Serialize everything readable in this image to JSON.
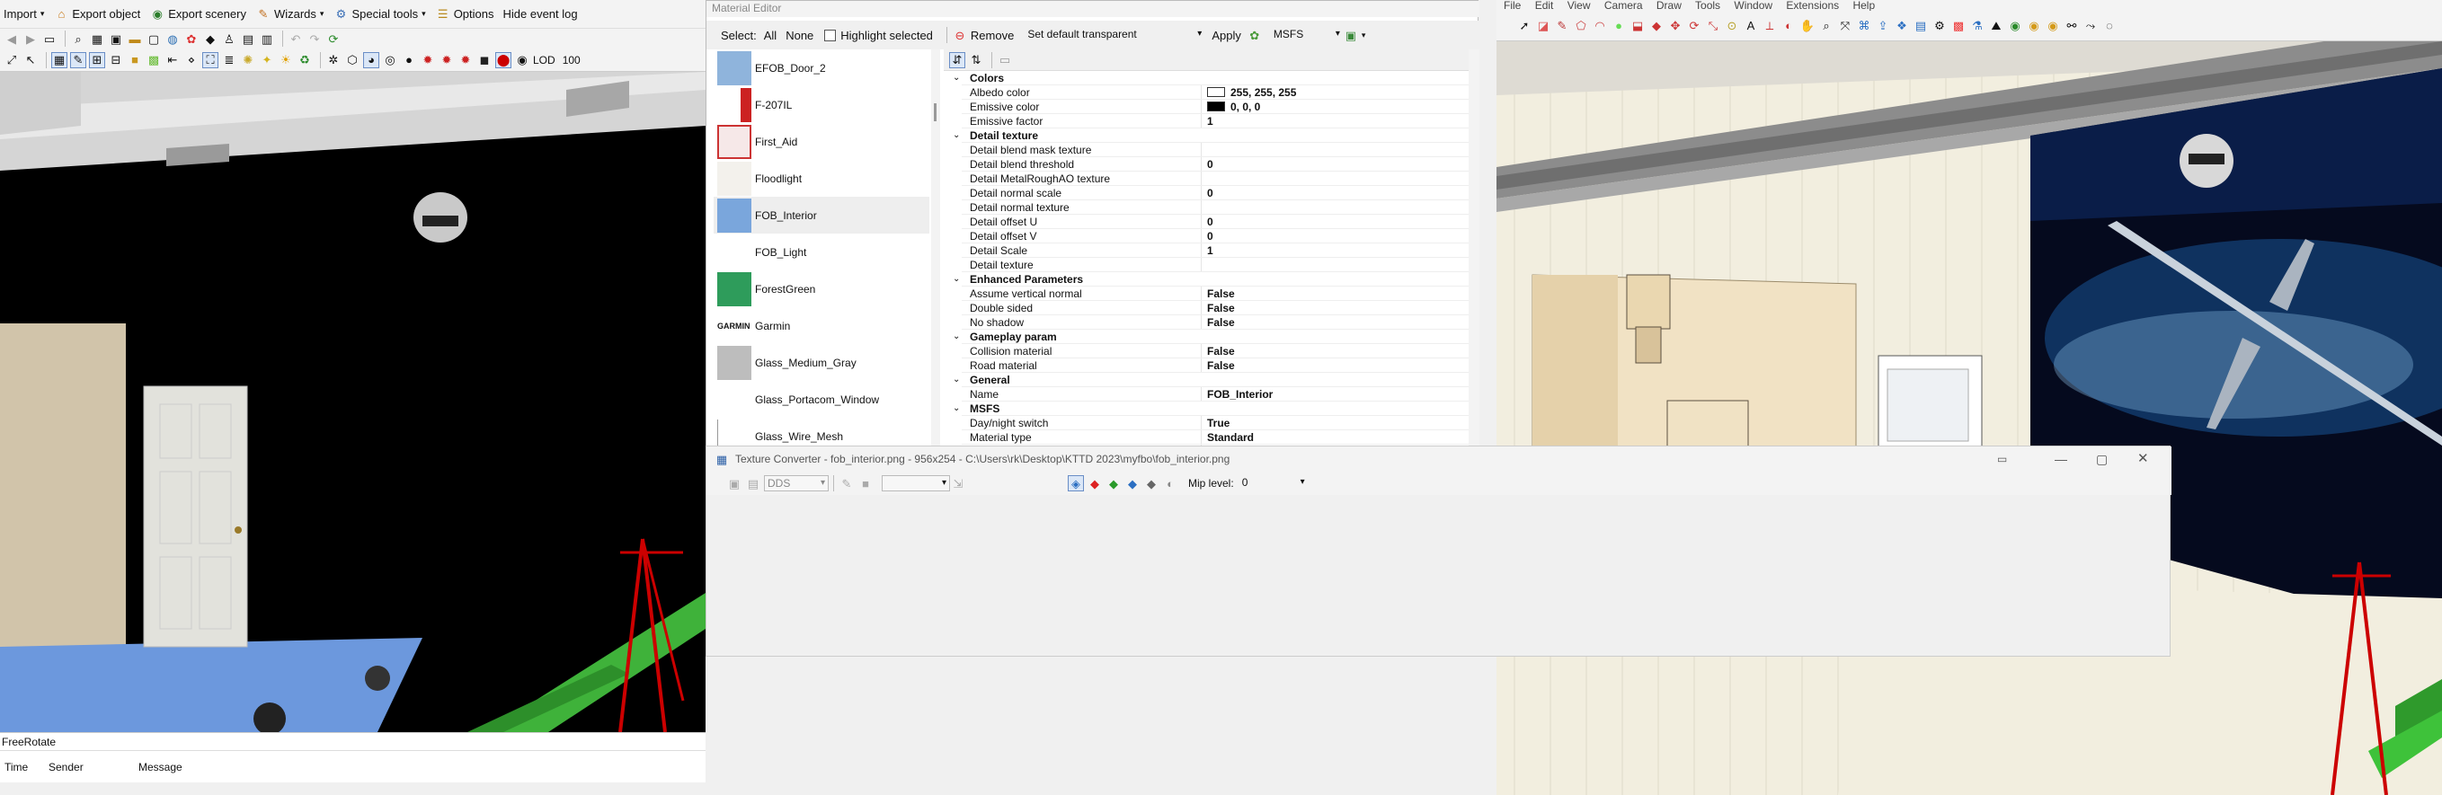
{
  "left_app": {
    "menu": {
      "import": "Import",
      "export_object": "Export object",
      "export_scenery": "Export scenery",
      "wizards": "Wizards",
      "special_tools": "Special tools",
      "options": "Options",
      "hide_event_log": "Hide event log"
    },
    "lod_label": "LOD",
    "lod_value": "100",
    "status_text": "FreeRotate",
    "log_columns": [
      "Time",
      "Sender",
      "Message"
    ]
  },
  "material_editor": {
    "title": "Material Editor",
    "toolbar": {
      "select_label": "Select:",
      "all": "All",
      "none": "None",
      "highlight_selected": "Highlight selected",
      "remove": "Remove",
      "default_transparent": "Set default transparent",
      "apply": "Apply",
      "msfs": "MSFS"
    },
    "materials": [
      {
        "name": "EFOB_Door_2",
        "swatch": "#8fb4dc"
      },
      {
        "name": "F-207IL",
        "swatch": "#ffffff"
      },
      {
        "name": "First_Aid",
        "swatch": "#f2e4e4"
      },
      {
        "name": "Floodlight",
        "swatch": "#f3f1ec"
      },
      {
        "name": "FOB_Interior",
        "swatch": "#7aa6dc"
      },
      {
        "name": "FOB_Light",
        "swatch": "#ffffff"
      },
      {
        "name": "ForestGreen",
        "swatch": "#2e9c5b"
      },
      {
        "name": "Garmin",
        "swatch": "#ffffff",
        "logo": "GARMIN"
      },
      {
        "name": "Glass_Medium_Gray",
        "swatch": "#bdbdbd"
      },
      {
        "name": "Glass_Portacom_Window",
        "swatch": "#ffffff"
      },
      {
        "name": "Glass_Wire_Mesh",
        "swatch": "#ffffff"
      }
    ],
    "properties": [
      {
        "type": "category",
        "label": "Colors"
      },
      {
        "label": "Albedo color",
        "value": "255, 255, 255",
        "color": "#ffffff"
      },
      {
        "label": "Emissive color",
        "value": "0, 0, 0",
        "color": "#000000"
      },
      {
        "label": "Emissive factor",
        "value": "1"
      },
      {
        "type": "category",
        "label": "Detail texture"
      },
      {
        "label": "Detail blend mask texture",
        "value": ""
      },
      {
        "label": "Detail blend threshold",
        "value": "0"
      },
      {
        "label": "Detail MetalRoughAO texture",
        "value": ""
      },
      {
        "label": "Detail normal scale",
        "value": "0"
      },
      {
        "label": "Detail normal texture",
        "value": ""
      },
      {
        "label": "Detail offset U",
        "value": "0"
      },
      {
        "label": "Detail offset V",
        "value": "0"
      },
      {
        "label": "Detail Scale",
        "value": "1"
      },
      {
        "label": "Detail texture",
        "value": ""
      },
      {
        "type": "category",
        "label": "Enhanced Parameters"
      },
      {
        "label": "Assume vertical normal",
        "value": "False"
      },
      {
        "label": "Double sided",
        "value": "False"
      },
      {
        "label": "No shadow",
        "value": "False"
      },
      {
        "type": "category",
        "label": "Gameplay param"
      },
      {
        "label": "Collision material",
        "value": "False"
      },
      {
        "label": "Road material",
        "value": "False"
      },
      {
        "type": "category",
        "label": "General"
      },
      {
        "label": "Name",
        "value": "FOB_Interior"
      },
      {
        "type": "category",
        "label": "MSFS"
      },
      {
        "label": "Day/night switch",
        "value": "True"
      },
      {
        "label": "Material type",
        "value": "Standard"
      }
    ]
  },
  "right_app": {
    "menu": [
      "File",
      "Edit",
      "View",
      "Camera",
      "Draw",
      "Tools",
      "Window",
      "Extensions",
      "Help"
    ]
  },
  "texture_converter": {
    "title": "Texture Converter - fob_interior.png - 956x254 - C:\\Users\\rk\\Desktop\\KTTD 2023\\myfbo\\fob_interior.png",
    "format": "DDS",
    "mip_label": "Mip level:",
    "mip_value": "0"
  }
}
